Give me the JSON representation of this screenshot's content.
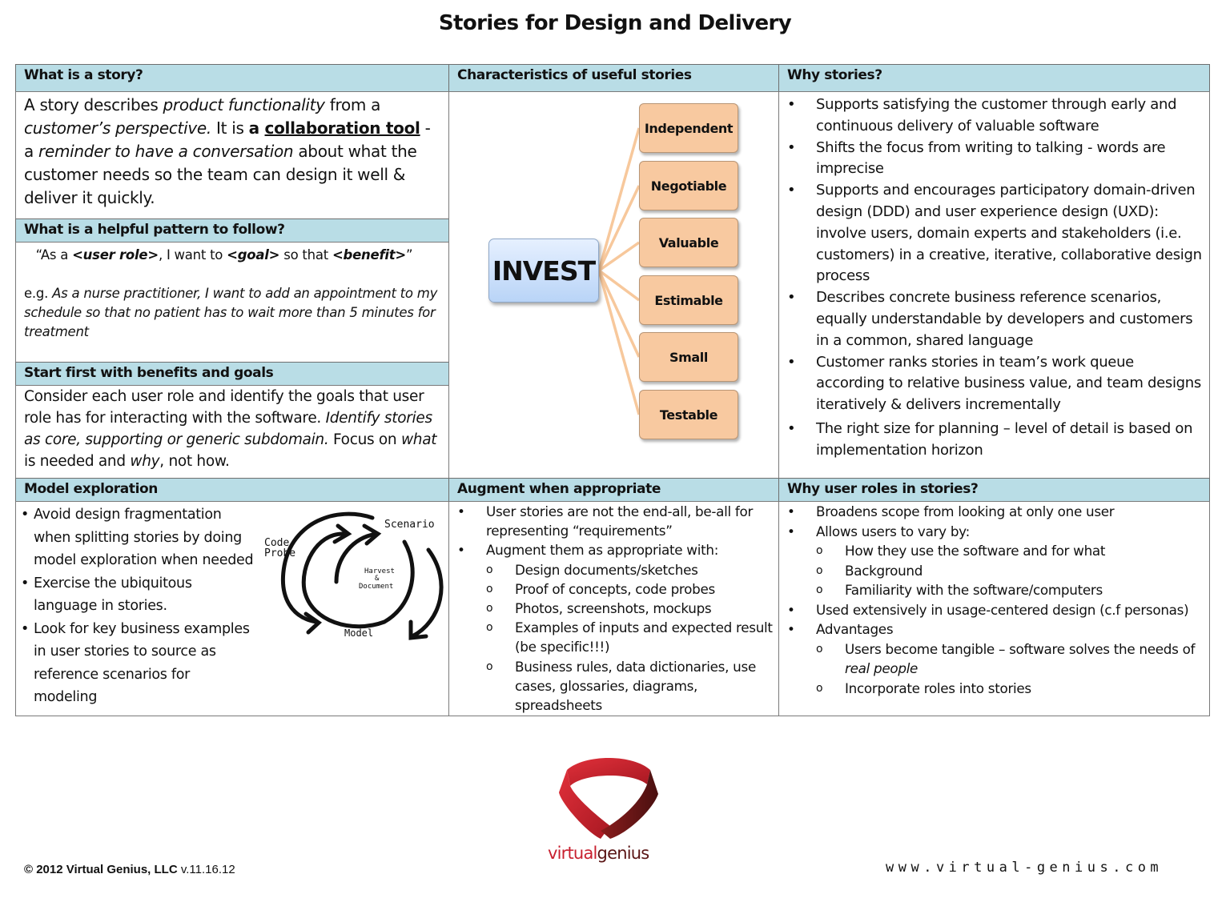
{
  "title": "Stories for Design and Delivery",
  "colors": {
    "header_bg": "#b9dde6",
    "invest_box": "#c5dcf9",
    "invest_item": "#f8c9a0",
    "connector": "#f7c89c",
    "logo_red": "#c8202f",
    "logo_dark": "#5a1414"
  },
  "what_is_story": {
    "heading": "What is a story?",
    "parts": {
      "p1": "A story describes ",
      "p2": "product functionality",
      "p3": " from a ",
      "p4": "customer’s perspective.",
      "p5": " It is ",
      "p6": "a ",
      "p7": "collaboration tool",
      "p8": " - a ",
      "p9": "reminder to have a conversation",
      "p10": " about what the customer needs so the team can design it well & deliver it quickly."
    }
  },
  "helpful_pattern": {
    "heading": "What is a helpful pattern to follow?",
    "template": {
      "q1": "“As a ",
      "role": "<user role>",
      "q2": ", I want to ",
      "goal": "<goal>",
      "q3": " so that ",
      "benefit": "<benefit>",
      "q4": "”"
    },
    "example_prefix": "e.g. ",
    "example": "As a nurse practitioner, I want to add an appointment to my schedule so that no patient has to wait more than 5 minutes for treatment"
  },
  "benefits_goals": {
    "heading": "Start first with benefits and goals",
    "parts": {
      "p1": "Consider each user role and identify the goals that user role has for interacting with the software. ",
      "p2": "Identify stories as core, supporting or generic subdomain.",
      "p3": " Focus on ",
      "p4": "what",
      "p5": " is needed and ",
      "p6": "why",
      "p7": ", not how."
    }
  },
  "characteristics": {
    "heading": "Characteristics of useful stories",
    "center": "INVEST",
    "items": [
      "Independent",
      "Negotiable",
      "Valuable",
      "Estimable",
      "Small",
      "Testable"
    ]
  },
  "why_stories": {
    "heading": "Why stories?",
    "items": [
      "Supports satisfying the customer through early and continuous delivery of valuable software",
      "Shifts the focus from writing to talking - words are imprecise",
      "Supports and encourages participatory domain-driven design (DDD) and user experience design (UXD): involve users, domain experts and stakeholders (i.e. customers) in a creative, iterative, collaborative design process",
      "Describes concrete business reference scenarios, equally understandable by developers and customers in a common, shared language",
      "Customer ranks stories in team’s work queue according to relative business value, and team designs iteratively & delivers incrementally",
      "The right size for planning – level of detail is based on implementation horizon"
    ]
  },
  "model_exploration": {
    "heading": "Model exploration",
    "items": [
      "Avoid design fragmentation when splitting stories by doing model exploration when needed",
      "Exercise the ubiquitous language in stories.",
      "Look for key business examples in user stories to source as reference scenarios for modeling"
    ],
    "diagram": {
      "code_probe_1": "Code",
      "code_probe_2": "Probe",
      "scenario": "Scenario",
      "harvest_1": "Harvest",
      "harvest_2": "&",
      "harvest_3": "Document",
      "model": "Model"
    }
  },
  "augment": {
    "heading": "Augment when appropriate",
    "items": [
      {
        "text": "User stories are not the end-all, be-all for representing “requirements”",
        "sub": []
      },
      {
        "text": "Augment them as appropriate with:",
        "sub": [
          "Design documents/sketches",
          "Proof of concepts, code probes",
          "Photos, screenshots, mockups",
          "Examples of inputs and expected result (be specific!!!)",
          "Business rules, data dictionaries, use cases, glossaries, diagrams, spreadsheets"
        ]
      }
    ]
  },
  "user_roles": {
    "heading": "Why user roles in stories?",
    "b1": "Broadens scope from looking at only one user",
    "b2": "Allows users to vary by:",
    "b2_sub": [
      "How they use the software and for what",
      "Background",
      "Familiarity with the software/computers"
    ],
    "b3": "Used extensively in usage-centered design (c.f personas)",
    "b4": "Advantages",
    "b4_sub1_a": "Users become tangible – software solves the needs of ",
    "b4_sub1_b": "real people",
    "b4_sub2": "Incorporate roles into stories"
  },
  "footer": {
    "copyright": "©  2012 Virtual Genius, LLC",
    "version": " v.11.16.12",
    "website": "www.virtual-genius.com",
    "logo_text_1": "virtual",
    "logo_text_2": "genius"
  }
}
